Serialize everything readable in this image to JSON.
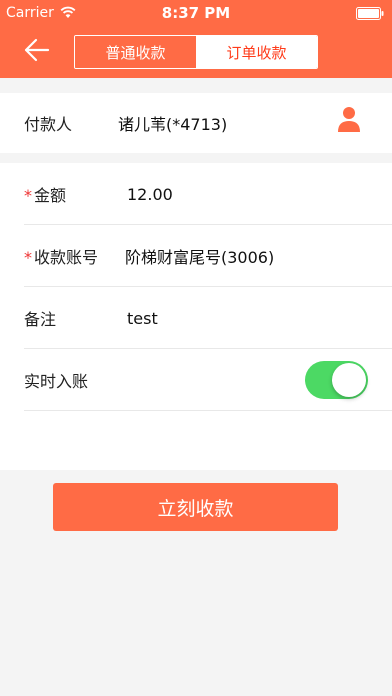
{
  "status_bar": {
    "carrier": "Carrier",
    "time": "8:37 PM"
  },
  "header": {
    "tabs": [
      {
        "label": "普通收款",
        "active": true
      },
      {
        "label": "订单收款",
        "active": false
      }
    ]
  },
  "payer": {
    "label": "付款人",
    "value": "诸儿苇(*4713)"
  },
  "form": {
    "amount": {
      "required": "*",
      "label": "金额",
      "value": "12.00"
    },
    "account": {
      "required": "*",
      "label": "收款账号",
      "value": "阶梯财富尾号(3006)"
    },
    "note": {
      "label": "备注",
      "value": "test"
    },
    "realtime": {
      "label": "实时入账",
      "enabled": true
    }
  },
  "submit_label": "立刻收款",
  "colors": {
    "accent": "#ff6b45",
    "toggle_on": "#4cd964",
    "required": "#e33333"
  }
}
